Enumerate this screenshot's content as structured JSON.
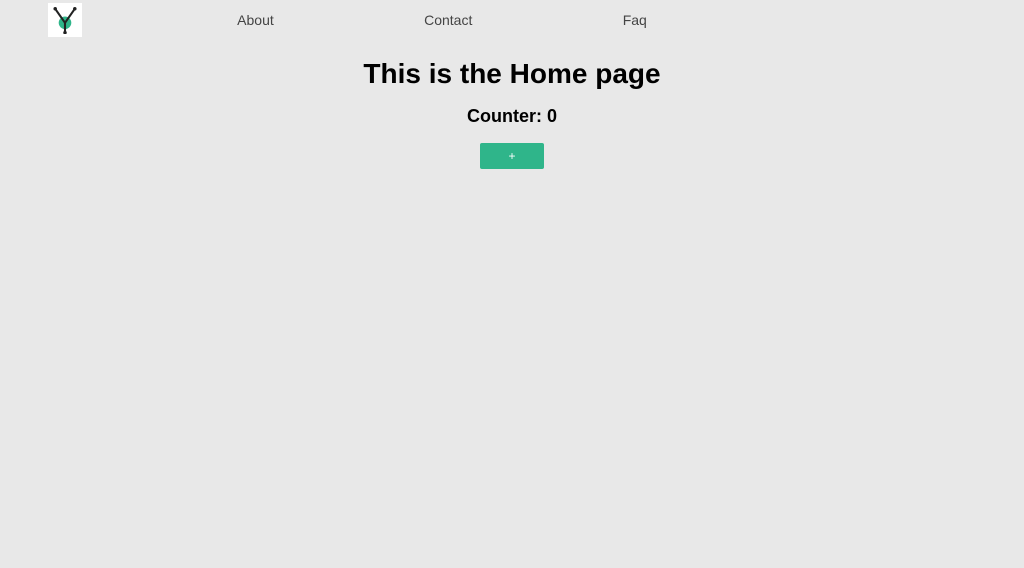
{
  "nav": {
    "links": [
      {
        "label": "About"
      },
      {
        "label": "Contact"
      },
      {
        "label": "Faq"
      }
    ]
  },
  "main": {
    "title": "This is the Home page",
    "counter_label": "Counter: ",
    "counter_value": "0",
    "increment_label": "+"
  },
  "colors": {
    "background": "#e8e8e8",
    "accent": "#2fb58a"
  }
}
